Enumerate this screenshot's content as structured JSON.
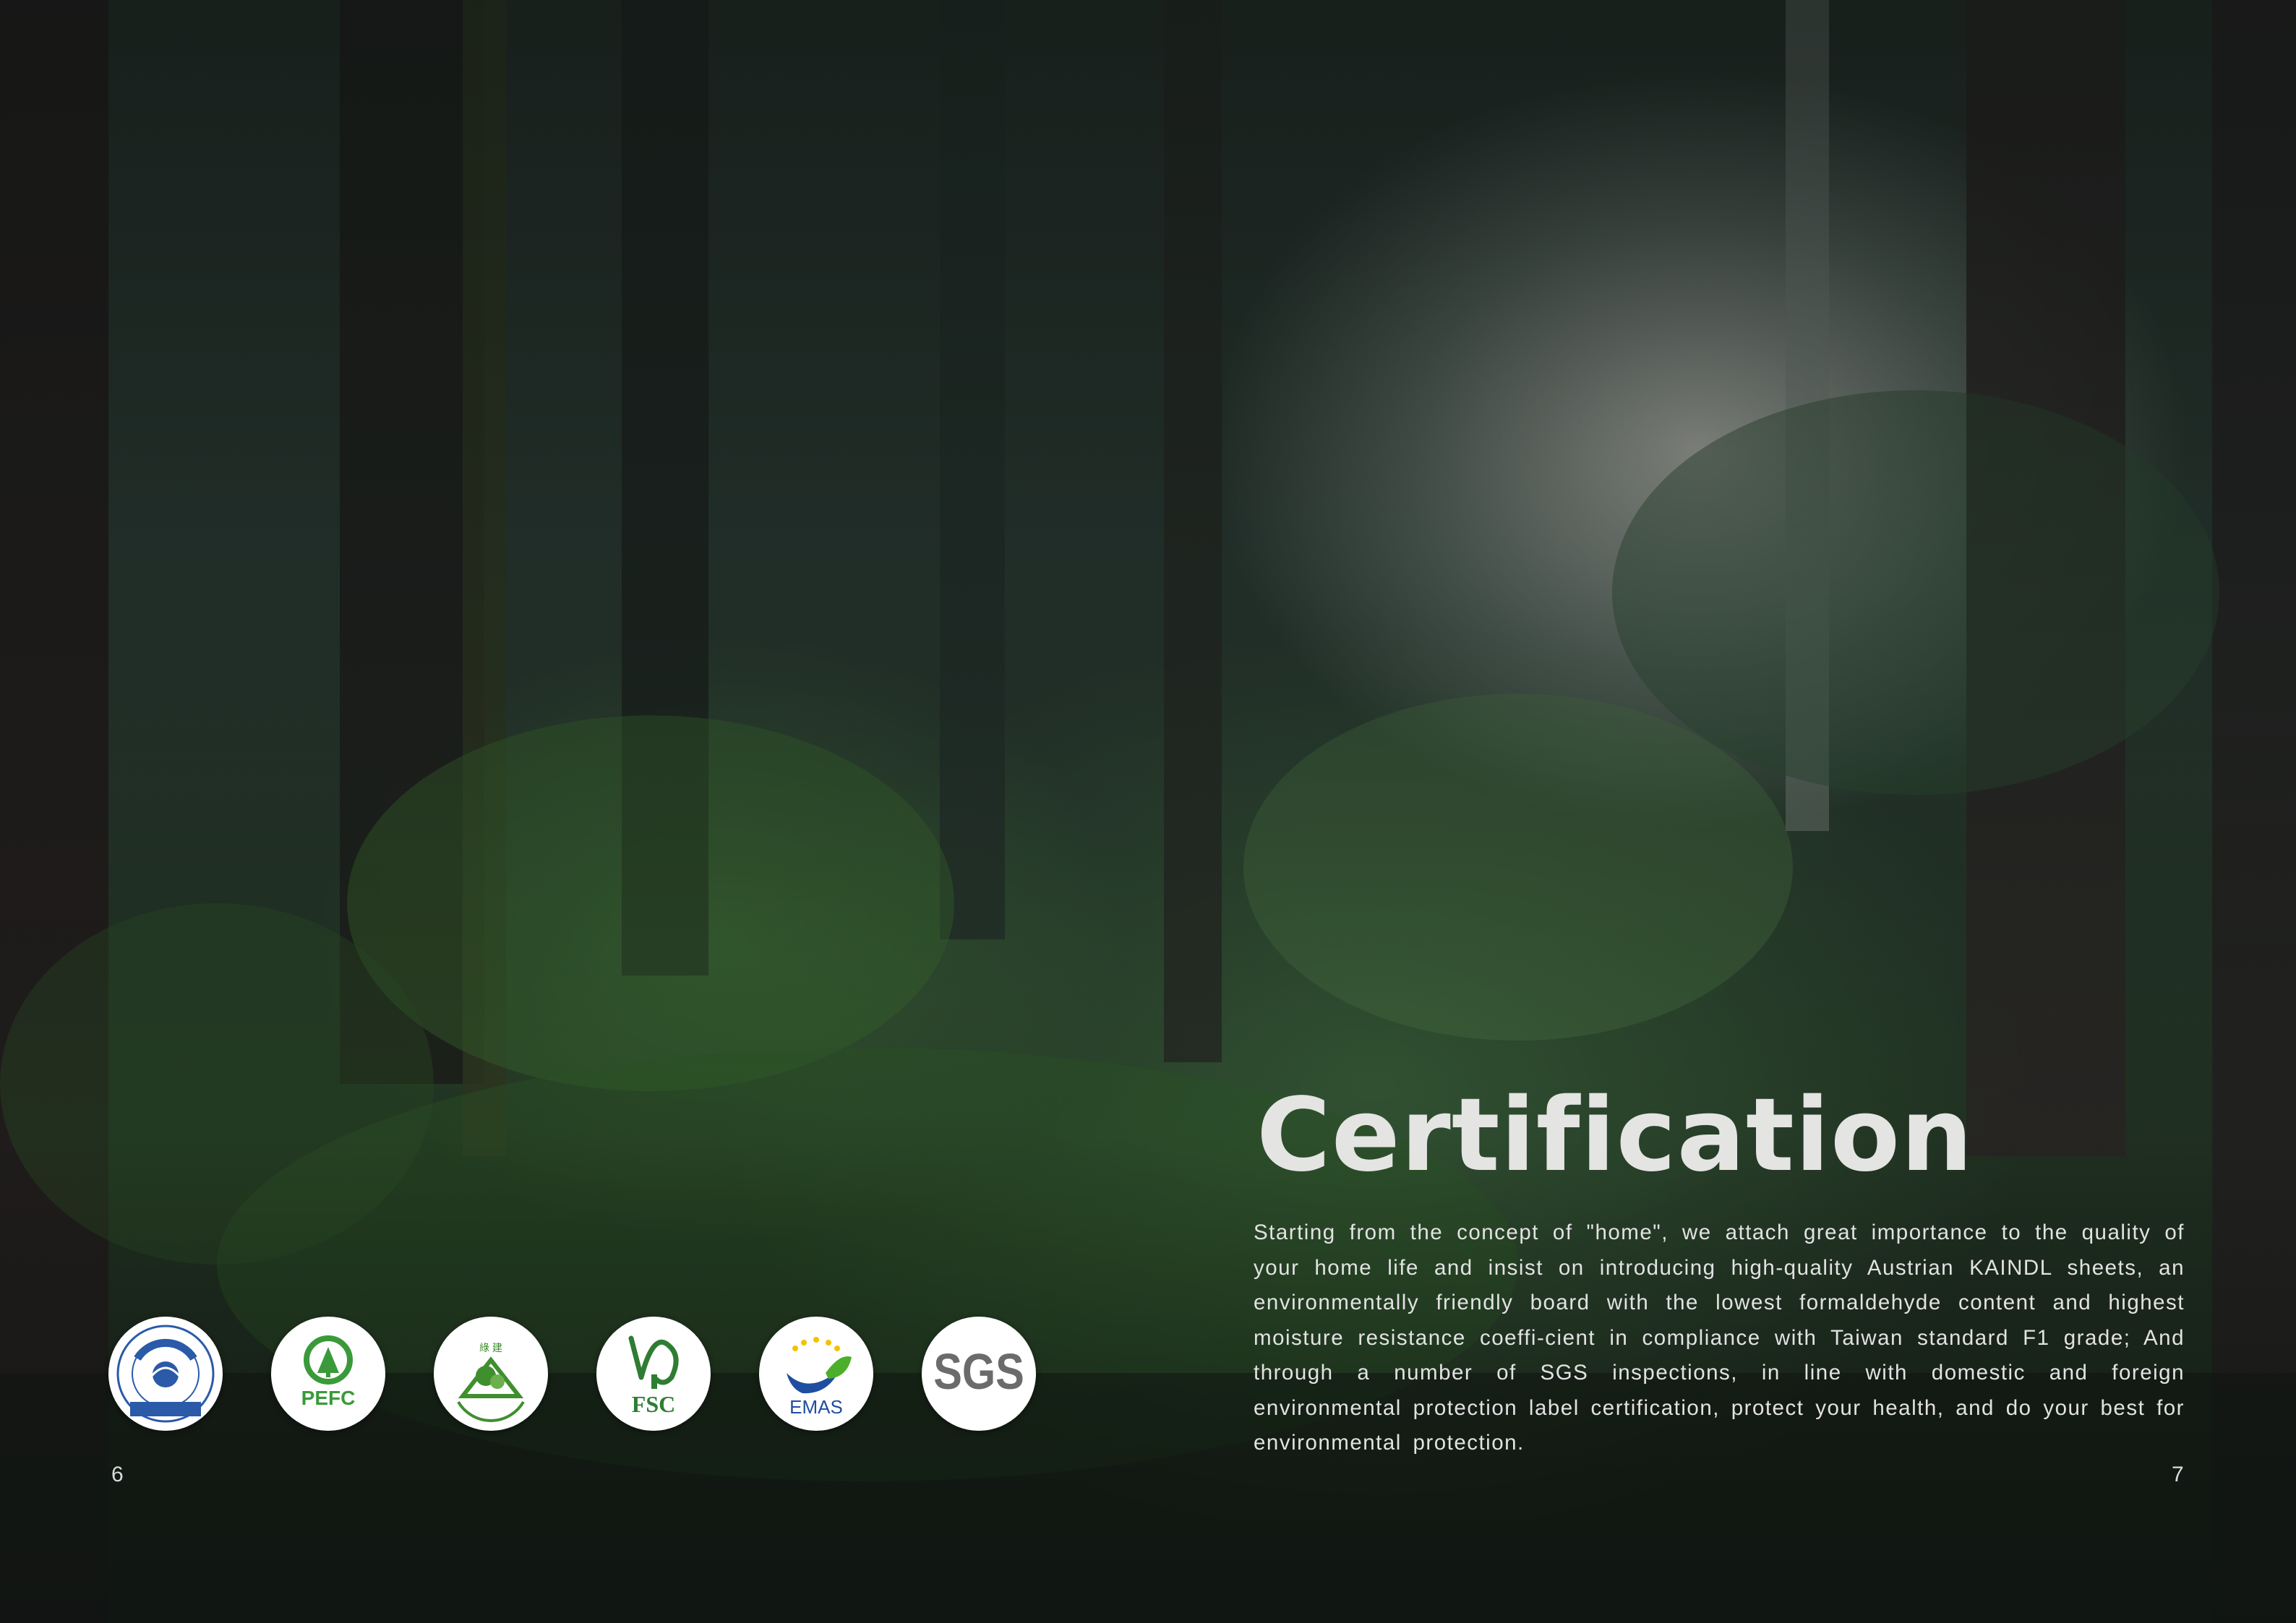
{
  "title": "Certification",
  "body": "Starting from the concept of \"home\", we attach great importance to the quality of your home life and insist on introducing high-quality Austrian KAINDL sheets, an environmentally friendly board with the lowest formaldehyde content and highest moisture resistance coeffi-cient in compliance with Taiwan standard F1 grade; And through a number of SGS inspections, in line with domestic and foreign environmental protection label certification, protect your health, and do your best for environmental protection.",
  "page_left": "6",
  "page_right": "7",
  "logos": [
    {
      "name": "blue-angel-logo",
      "label": "DER BLAUE ENGEL"
    },
    {
      "name": "pefc-logo",
      "label": "PEFC"
    },
    {
      "name": "green-building-logo",
      "label": "Green Building Material"
    },
    {
      "name": "fsc-logo",
      "label": "FSC"
    },
    {
      "name": "emas-logo",
      "label": "EMAS"
    },
    {
      "name": "sgs-logo",
      "label": "SGS"
    }
  ],
  "colors": {
    "blue_angel": "#2a5aa8",
    "pefc_green": "#3a9a3a",
    "green_building": "#3f8f2f",
    "fsc_green": "#2e7d32",
    "emas_blue": "#1f4ea0",
    "emas_green": "#4caf2a",
    "sgs_gray": "#6b6b6b"
  }
}
